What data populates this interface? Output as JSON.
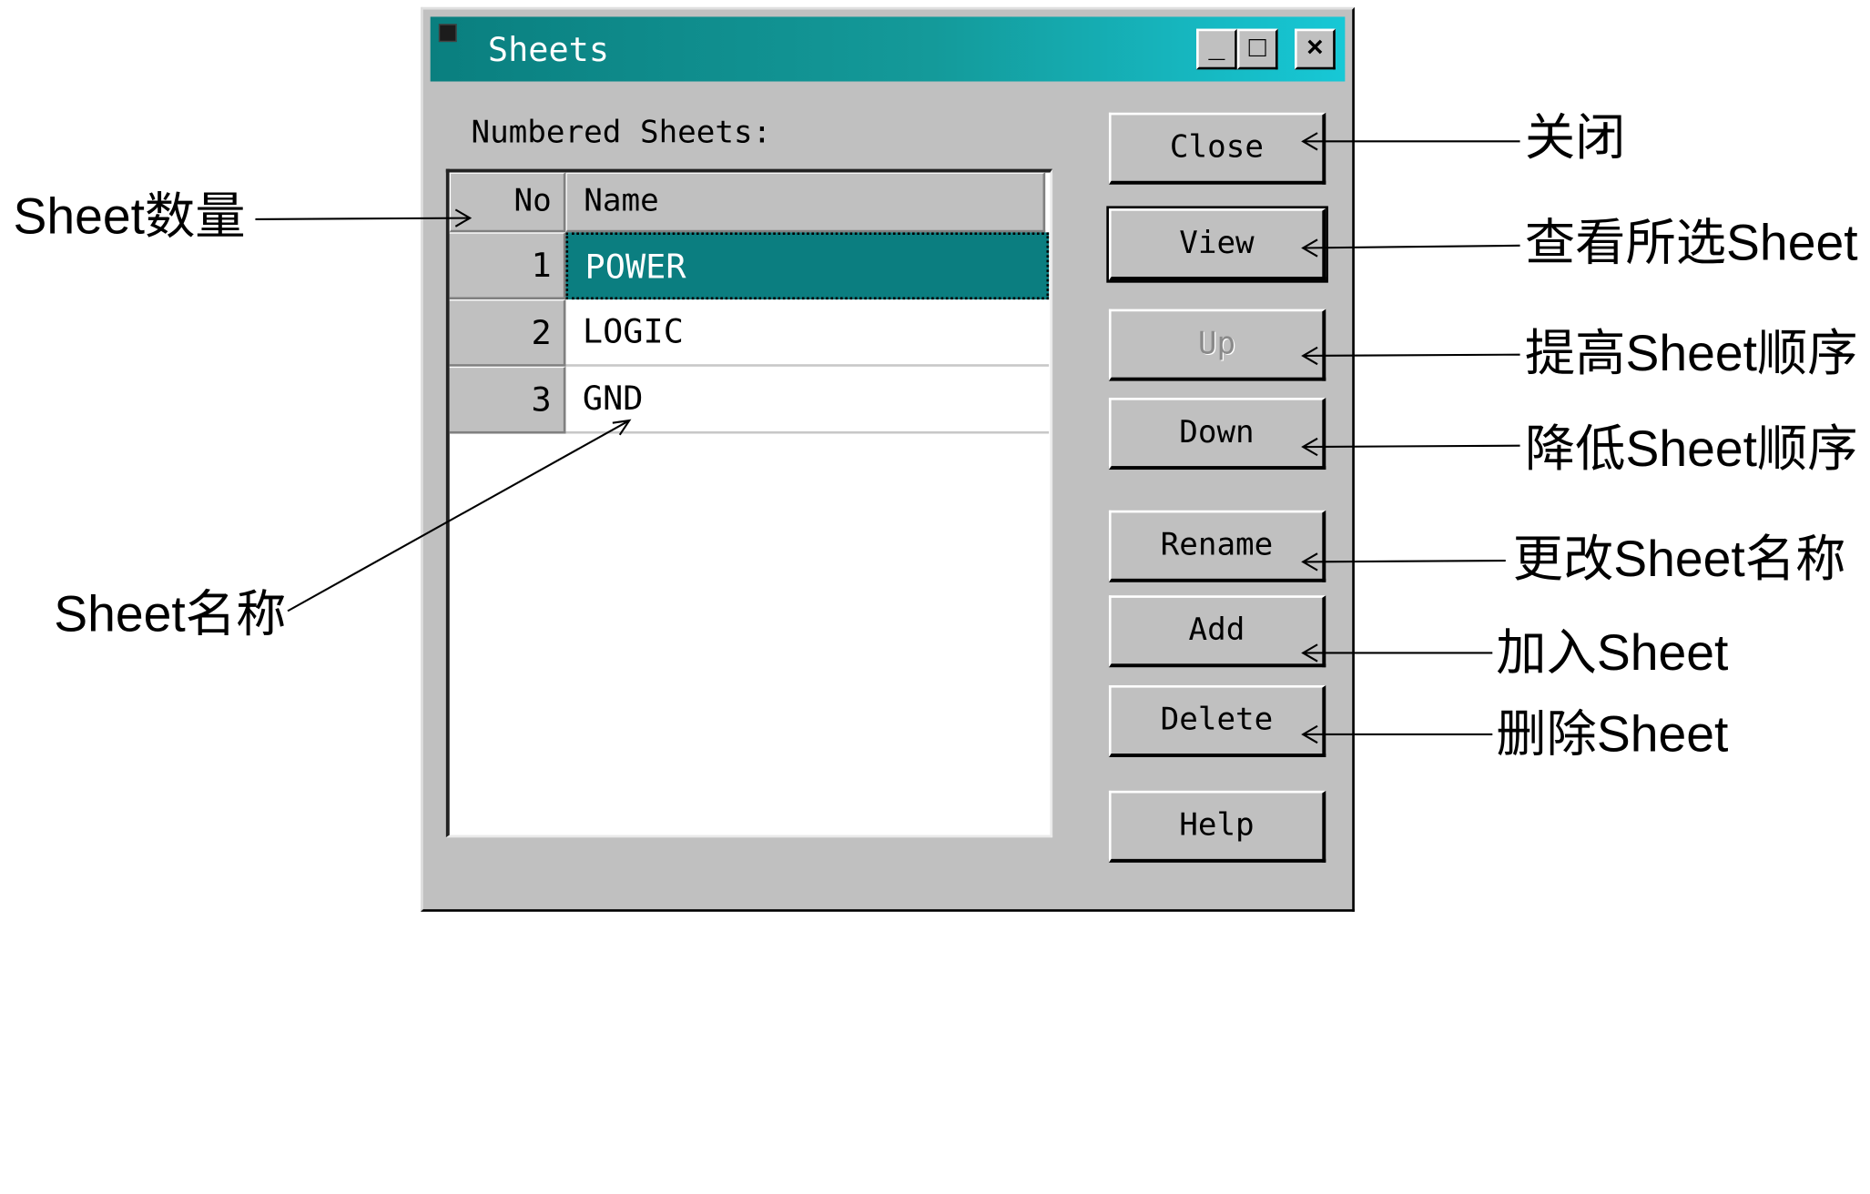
{
  "window": {
    "title": "Sheets"
  },
  "titlebar_buttons": {
    "minimize": "_",
    "maximize": "□",
    "close": "×"
  },
  "list_label": "Numbered Sheets:",
  "table": {
    "headers": {
      "no": "No",
      "name": "Name"
    },
    "rows": [
      {
        "no": "1",
        "name": "POWER",
        "selected": true
      },
      {
        "no": "2",
        "name": "LOGIC",
        "selected": false
      },
      {
        "no": "3",
        "name": "GND",
        "selected": false
      }
    ]
  },
  "buttons": {
    "close": "Close",
    "view": "View",
    "up": "Up",
    "down": "Down",
    "rename": "Rename",
    "add": "Add",
    "delete": "Delete",
    "help": "Help"
  },
  "annotations": {
    "sheet_count": "Sheet数量",
    "sheet_name": "Sheet名称",
    "close": "关闭",
    "view": "查看所选Sheet",
    "up": "提高Sheet顺序",
    "down": "降低Sheet顺序",
    "rename": "更改Sheet名称",
    "add": "加入Sheet",
    "delete": "删除Sheet"
  },
  "colors": {
    "titlebar_start": "#0a7f7f",
    "titlebar_end": "#17c8d6",
    "selection": "#0b7e80",
    "dialog_face": "#c0c0c0"
  }
}
